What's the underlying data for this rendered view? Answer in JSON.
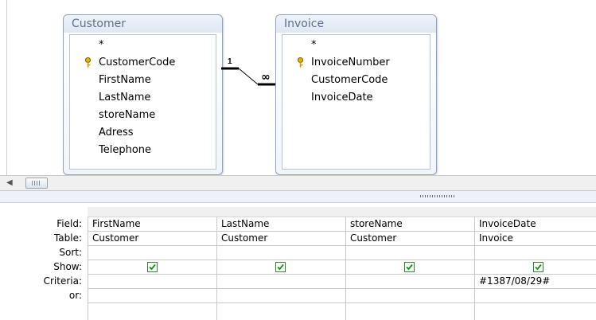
{
  "tables": {
    "customer": {
      "title": "Customer",
      "fields": [
        "*",
        "CustomerCode",
        "FirstName",
        "LastName",
        "storeName",
        "Adress",
        "Telephone"
      ]
    },
    "invoice": {
      "title": "Invoice",
      "fields": [
        "*",
        "InvoiceNumber",
        "CustomerCode",
        "InvoiceDate"
      ]
    }
  },
  "relationship": {
    "one_label": "1",
    "many_label": "∞"
  },
  "grid": {
    "row_labels": {
      "field": "Field:",
      "table": "Table:",
      "sort": "Sort:",
      "show": "Show:",
      "criteria": "Criteria:",
      "or": "or:"
    },
    "columns": [
      {
        "field": "FirstName",
        "table": "Customer",
        "sort": "",
        "show": true,
        "criteria": "",
        "or": ""
      },
      {
        "field": "LastName",
        "table": "Customer",
        "sort": "",
        "show": true,
        "criteria": "",
        "or": ""
      },
      {
        "field": "storeName",
        "table": "Customer",
        "sort": "",
        "show": true,
        "criteria": "",
        "or": ""
      },
      {
        "field": "InvoiceDate",
        "table": "Invoice",
        "sort": "",
        "show": true,
        "criteria": "#1387/08/29#",
        "or": ""
      }
    ]
  },
  "icons": {
    "key": "key-icon",
    "check": "checkmark-icon",
    "scroll_left": "scroll-left-arrow-icon"
  }
}
